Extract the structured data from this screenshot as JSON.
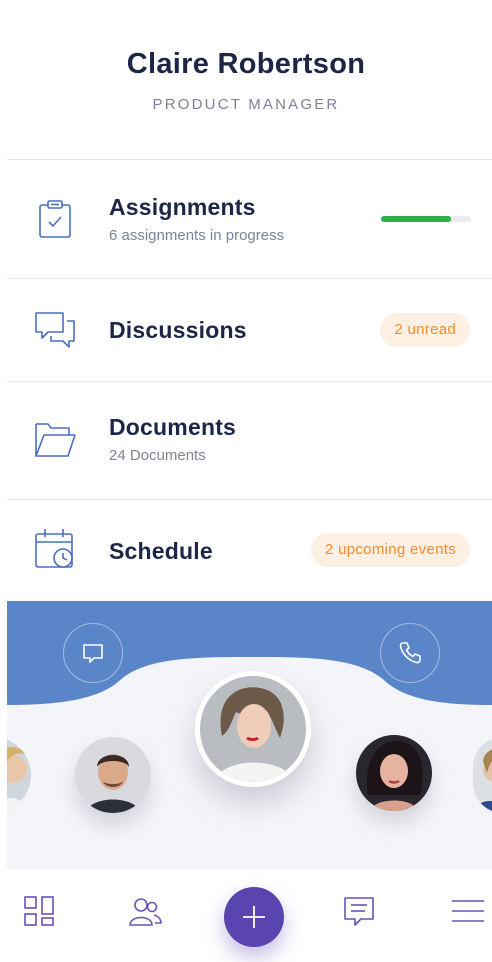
{
  "profile": {
    "name": "Claire Robertson",
    "role": "PRODUCT MANAGER"
  },
  "menu": [
    {
      "title": "Assignments",
      "subtitle": "6 assignments in progress",
      "icon": "clipboard-check-icon",
      "progress": 0.78,
      "progress_color": "#2db04a"
    },
    {
      "title": "Discussions",
      "icon": "chat-bubbles-icon",
      "badge": "2 unread"
    },
    {
      "title": "Documents",
      "subtitle": "24 Documents",
      "icon": "folder-icon"
    },
    {
      "title": "Schedule",
      "icon": "calendar-clock-icon",
      "badge": "2 upcoming events"
    }
  ],
  "carousel": {
    "accent": "#5a85c8",
    "left_action_icon": "message-icon",
    "right_action_icon": "phone-icon"
  },
  "bottom_nav": {
    "items": [
      "dashboard-grid-icon",
      "people-icon",
      "plus-icon",
      "chat-icon",
      "menu-icon"
    ],
    "fab_color": "#5a45b0"
  },
  "colors": {
    "primary_text": "#1d2647",
    "muted_text": "#7d8299",
    "badge_text": "#f08c2e",
    "badge_bg": "#fdf0e3",
    "icon": "#4a6fc0"
  }
}
